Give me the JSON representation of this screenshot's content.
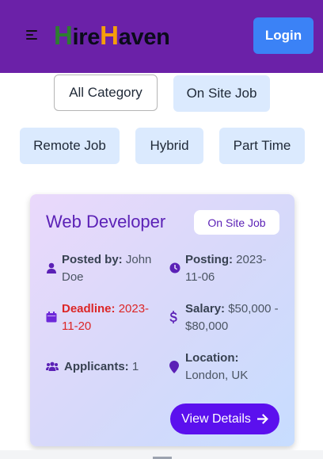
{
  "navbar": {
    "logo": {
      "part1": "H",
      "part2": "ire",
      "part3": "H",
      "part4": "aven"
    },
    "login_label": "Login",
    "colors": {
      "background": "#6b21a8",
      "login": "#3b82f6",
      "logo_green": "#2e7d32",
      "logo_orange": "#f59e0b"
    }
  },
  "categories": [
    {
      "label": "All Category",
      "active": true
    },
    {
      "label": "On Site Job",
      "active": false
    },
    {
      "label": "Remote Job",
      "active": false
    },
    {
      "label": "Hybrid",
      "active": false
    },
    {
      "label": "Part Time",
      "active": false
    }
  ],
  "job": {
    "title": "Web Developer",
    "type": "On Site Job",
    "posted_by_label": "Posted by:",
    "posted_by": "John Doe",
    "posting_label": "Posting:",
    "posting": "2023-11-06",
    "deadline_label": "Deadline:",
    "deadline": "2023-11-20",
    "salary_label": "Salary:",
    "salary": "$50,000 - $80,000",
    "applicants_label": "Applicants:",
    "applicants": "1",
    "location_label": "Location:",
    "location": "London, UK",
    "view_label": "View Details",
    "icons": [
      "user-icon",
      "clock-icon",
      "calendar-icon",
      "dollar-icon",
      "users-icon",
      "map-pin-icon",
      "arrow-right-icon"
    ]
  }
}
